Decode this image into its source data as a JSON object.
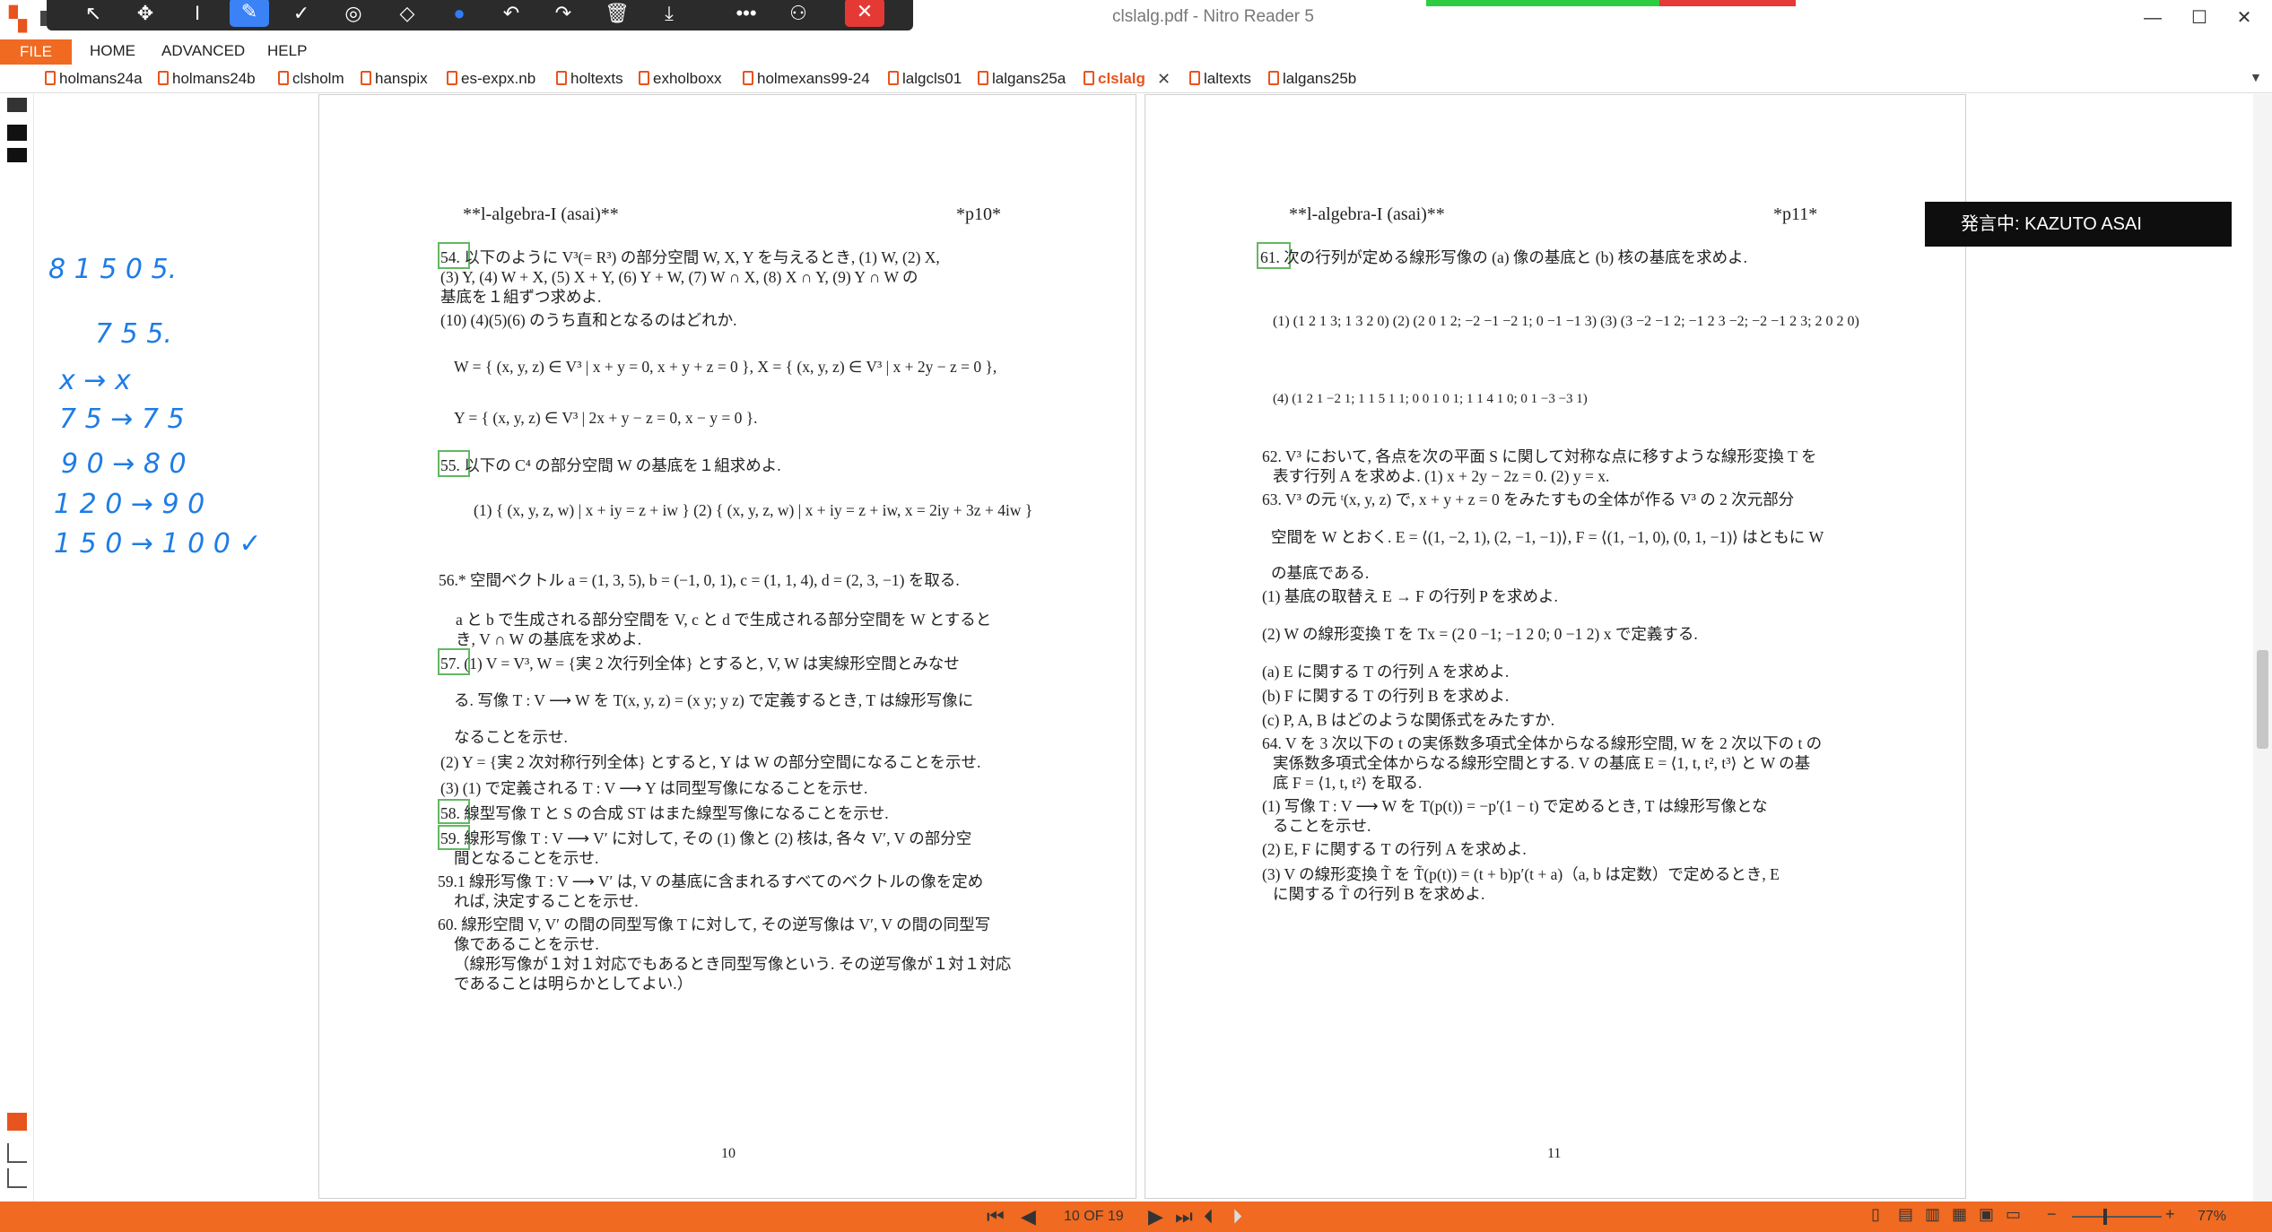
{
  "window": {
    "title": "clslalg.pdf - Nitro Reader 5"
  },
  "menu": {
    "file": "FILE",
    "home": "HOME",
    "advanced": "ADVANCED",
    "help": "HELP"
  },
  "tabs": [
    "holmans24a",
    "holmans24b",
    "clsholm",
    "hanspix",
    "es-expx.nb",
    "holtexts",
    "exholboxx",
    "holmexans99-24",
    "lalgcls01",
    "lalgans25a",
    "clslalg",
    "laltexts",
    "lalgans25b"
  ],
  "speaker": "発言中: KAZUTO ASAI",
  "annotations": [
    "8 1 5 0 5.",
    "7 5 5.",
    "x → x",
    "7 5 → 7 5",
    "9 0 → 8 0",
    "1 2 0 → 9 0",
    "1 5 0 → 1 0 0 ✓"
  ],
  "page10": {
    "header_left": "**l-algebra-I (asai)**",
    "header_right": "*p10*",
    "page_number": "10",
    "lines": [
      "54. 以下のように V³(= R³) の部分空間 W, X, Y を与えるとき, (1) W, (2) X,",
      "(3) Y, (4) W + X, (5) X + Y, (6) Y + W, (7) W ∩ X, (8) X ∩ Y, (9) Y ∩ W の",
      "基底を１組ずつ求めよ.",
      "(10) (4)(5)(6) のうち直和となるのはどれか.",
      "W = { (x, y, z) ∈ V³ | x + y = 0, x + y + z = 0 },  X = { (x, y, z) ∈ V³ | x + 2y − z = 0 },",
      "Y = { (x, y, z) ∈ V³ | 2x + y − z = 0, x − y = 0 }.",
      "55. 以下の C⁴ の部分空間 W の基底を１組求めよ.",
      "(1) { (x, y, z, w) | x + iy = z + iw }     (2) { (x, y, z, w) | x + iy = z + iw, x = 2iy + 3z + 4iw }",
      "56.* 空間ベクトル a = (1, 3, 5), b = (−1, 0, 1), c = (1, 1, 4), d = (2, 3, −1) を取る.",
      "a と b で生成される部分空間を V, c と d で生成される部分空間を W とすると",
      "き, V ∩ W の基底を求めよ.",
      "57. (1) V = V³, W = {実 2 次行列全体} とすると, V, W は実線形空間とみなせ",
      "る. 写像 T : V ⟶ W を T(x, y, z) = (x y; y z) で定義するとき, T は線形写像に",
      "なることを示せ.",
      "(2) Y = {実 2 次対称行列全体} とすると, Y は W の部分空間になることを示せ.",
      "(3) (1) で定義される T : V ⟶ Y は同型写像になることを示せ.",
      "58. 線型写像 T と S の合成 ST はまた線型写像になることを示せ.",
      "59. 線形写像 T : V ⟶ V′ に対して, その (1) 像と (2) 核は, 各々 V′, V の部分空",
      "間となることを示せ.",
      "59.1 線形写像 T : V ⟶ V′ は, V の基底に含まれるすべてのベクトルの像を定め",
      "れば, 決定することを示せ.",
      "60. 線形空間 V, V′ の間の同型写像 T に対して, その逆写像は V′, V の間の同型写",
      "像であることを示せ.",
      "（線形写像が１対１対応でもあるとき同型写像という. その逆写像が１対１対応",
      "であることは明らかとしてよい.）"
    ]
  },
  "page11": {
    "header_left": "**l-algebra-I (asai)**",
    "header_right": "*p11*",
    "page_number": "11",
    "lines": [
      "61. 次の行列が定める線形写像の (a) 像の基底と (b) 核の基底を求めよ.",
      "(1) (1 2 1 3; 1 3 2 0)   (2) (2 0 1 2; −2 −1 −2 1; 0 −1 −1 3)   (3) (3 −2 −1 2; −1 2 3 −2; −2 −1 2 3; 2 0 2 0)",
      "(4) (1 2 1 −2 1; 1 1 5 1 1; 0 0 1 0 1; 1 1 4 1 0; 0 1 −3 −3 1)",
      "62. V³ において, 各点を次の平面 S に関して対称な点に移すような線形変換 T を",
      "表す行列 A を求めよ.   (1) x + 2y − 2z = 0.   (2) y = x.",
      "63. V³ の元 ᵗ(x, y, z) で, x + y + z = 0 をみたすもの全体が作る V³ の 2 次元部分",
      "空間を W とおく. E = ⟨(1, −2, 1), (2, −1, −1)⟩, F = ⟨(1, −1, 0), (0, 1, −1)⟩ はともに W",
      "の基底である.",
      "(1) 基底の取替え E → F の行列 P を求めよ.",
      "(2) W の線形変換 T を Tx = (2 0 −1; −1 2 0; 0 −1 2) x で定義する.",
      "(a) E に関する T の行列 A を求めよ.",
      "(b) F に関する T の行列 B を求めよ.",
      "(c) P, A, B はどのような関係式をみたすか.",
      "64. V を 3 次以下の t の実係数多項式全体からなる線形空間, W を 2 次以下の t の",
      "実係数多項式全体からなる線形空間とする. V の基底 E = ⟨1, t, t², t³⟩ と W の基",
      "底 F = ⟨1, t, t²⟩ を取る.",
      "(1) 写像 T : V ⟶ W を T(p(t)) = −p′(1 − t) で定めるとき, T は線形写像とな",
      "ることを示せ.",
      "(2) E, F に関する T の行列 A を求めよ.",
      "(3) V の線形変換 T̃ を T̃(p(t)) = (t + b)p′(t + a)（a, b は定数）で定めるとき, E",
      "に関する T̃ の行列 B を求めよ."
    ]
  },
  "status": {
    "page": "10 OF 19",
    "zoom": "77%"
  },
  "colors": {
    "accent": "#f06a22",
    "ink": "#1e7ce6",
    "box": "#62b862"
  }
}
